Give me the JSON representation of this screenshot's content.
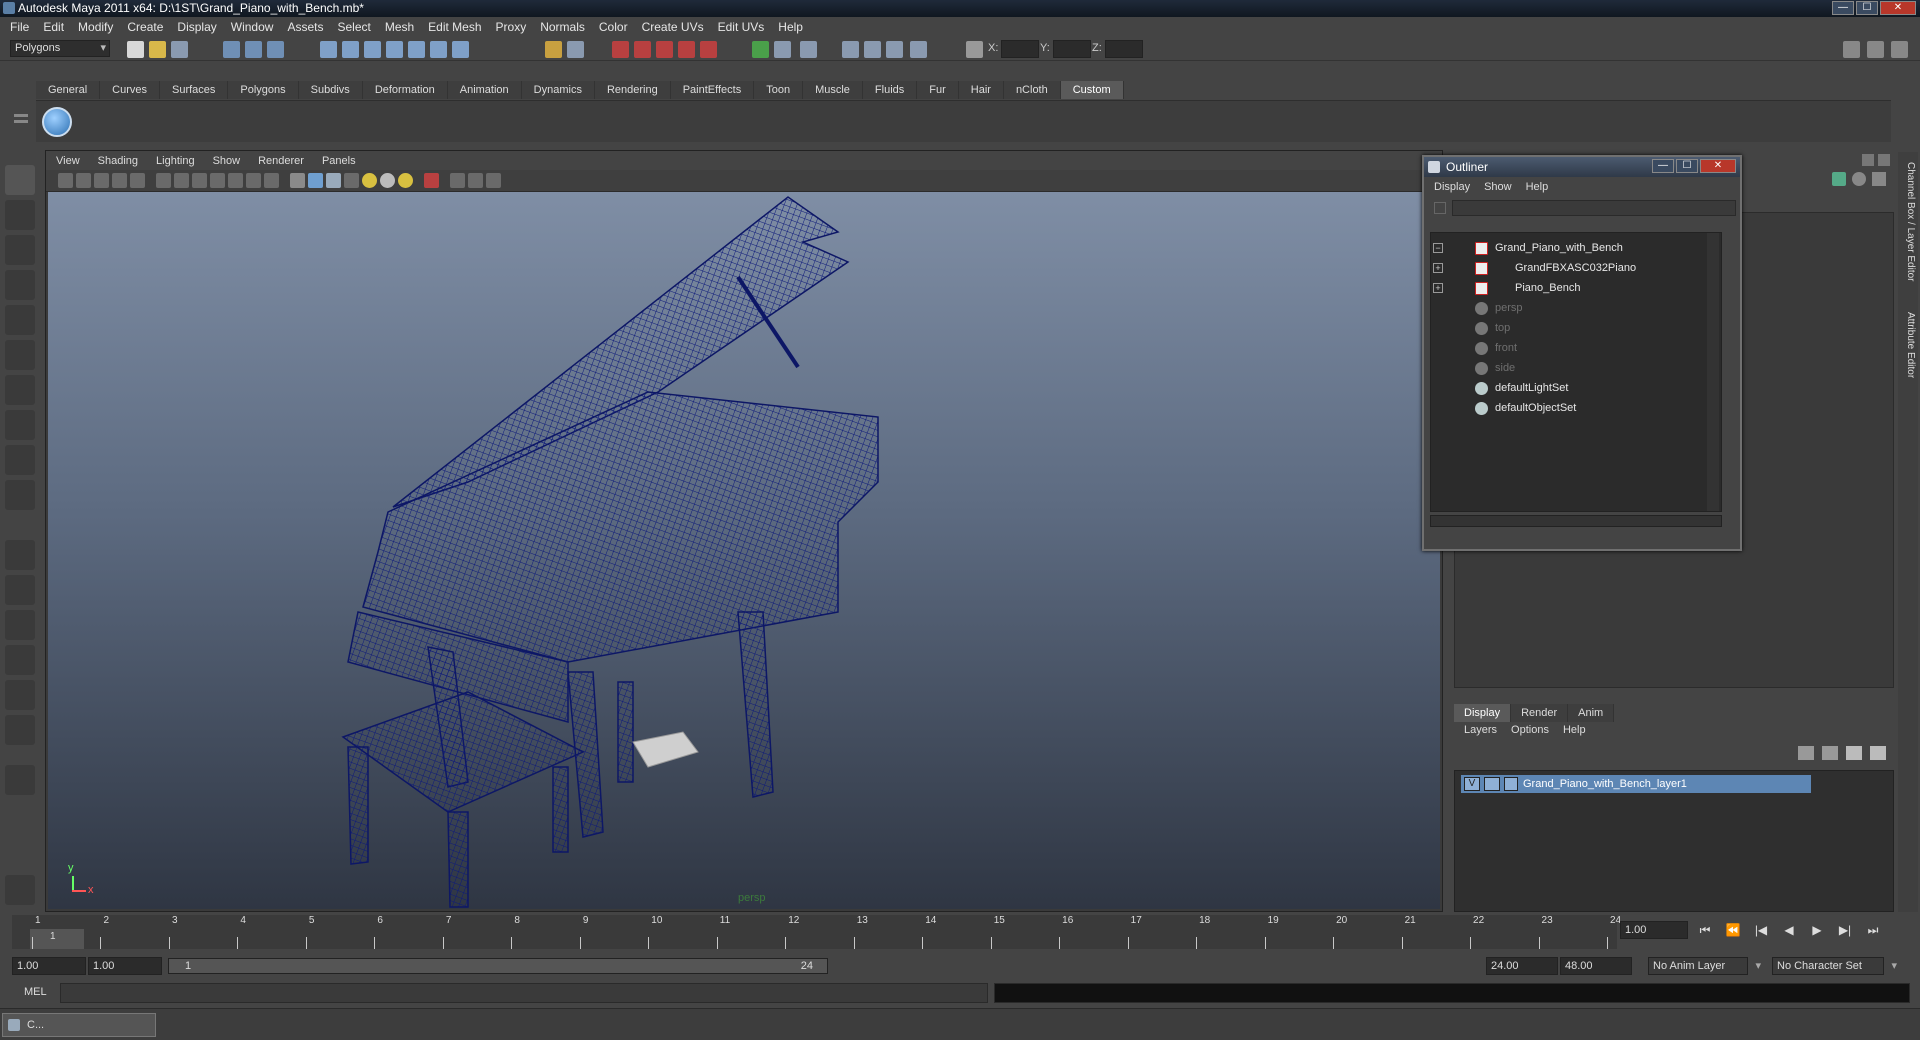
{
  "window": {
    "title": "Autodesk Maya 2011 x64: D:\\1ST\\Grand_Piano_with_Bench.mb*",
    "min_label": "—",
    "max_label": "☐",
    "close_label": "✕"
  },
  "menubar": [
    "File",
    "Edit",
    "Modify",
    "Create",
    "Display",
    "Window",
    "Assets",
    "Select",
    "Mesh",
    "Edit Mesh",
    "Proxy",
    "Normals",
    "Color",
    "Create UVs",
    "Edit UVs",
    "Help"
  ],
  "statusline": {
    "mode": "Polygons",
    "x_label": "X:",
    "y_label": "Y:",
    "z_label": "Z:"
  },
  "shelf": {
    "tabs": [
      "General",
      "Curves",
      "Surfaces",
      "Polygons",
      "Subdivs",
      "Deformation",
      "Animation",
      "Dynamics",
      "Rendering",
      "PaintEffects",
      "Toon",
      "Muscle",
      "Fluids",
      "Fur",
      "Hair",
      "nCloth",
      "Custom"
    ],
    "active_tab": "Custom"
  },
  "viewport": {
    "menu": [
      "View",
      "Shading",
      "Lighting",
      "Show",
      "Renderer",
      "Panels"
    ],
    "camera": "persp",
    "axis_x": "x",
    "axis_y": "y"
  },
  "outliner": {
    "title": "Outliner",
    "menu": [
      "Display",
      "Show",
      "Help"
    ],
    "items": [
      {
        "label": "Grand_Piano_with_Bench",
        "kind": "mesh",
        "dim": false,
        "expander": "−"
      },
      {
        "label": "GrandFBXASC032Piano",
        "kind": "mesh",
        "dim": false,
        "expander": "+"
      },
      {
        "label": "Piano_Bench",
        "kind": "mesh",
        "dim": false,
        "expander": "+"
      },
      {
        "label": "persp",
        "kind": "camera",
        "dim": true,
        "expander": ""
      },
      {
        "label": "top",
        "kind": "camera",
        "dim": true,
        "expander": ""
      },
      {
        "label": "front",
        "kind": "camera",
        "dim": true,
        "expander": ""
      },
      {
        "label": "side",
        "kind": "camera",
        "dim": true,
        "expander": ""
      },
      {
        "label": "defaultLightSet",
        "kind": "set",
        "dim": false,
        "expander": ""
      },
      {
        "label": "defaultObjectSet",
        "kind": "set",
        "dim": false,
        "expander": ""
      }
    ]
  },
  "layer_editor": {
    "tabs": [
      "Display",
      "Render",
      "Anim"
    ],
    "active_tab": "Display",
    "menu": [
      "Layers",
      "Options",
      "Help"
    ],
    "layer_visibility": "V",
    "layer_name": "Grand_Piano_with_Bench_layer1"
  },
  "side_tabs": [
    "Channel Box / Layer Editor",
    "Attribute Editor"
  ],
  "timeline": {
    "frames": [
      "1",
      "2",
      "3",
      "4",
      "5",
      "6",
      "7",
      "8",
      "9",
      "10",
      "11",
      "12",
      "13",
      "14",
      "15",
      "16",
      "17",
      "18",
      "19",
      "20",
      "21",
      "22",
      "23",
      "24"
    ],
    "current_frame": "1.00",
    "current_marker": "1"
  },
  "range": {
    "start": "1.00",
    "playback_start": "1.00",
    "slider_start": "1",
    "slider_end": "24",
    "playback_end": "24.00",
    "end": "48.00",
    "anim_layer": "No Anim Layer",
    "character_set": "No Character Set"
  },
  "command": {
    "label": "MEL"
  },
  "taskbar": {
    "minimized_label": "C..."
  }
}
